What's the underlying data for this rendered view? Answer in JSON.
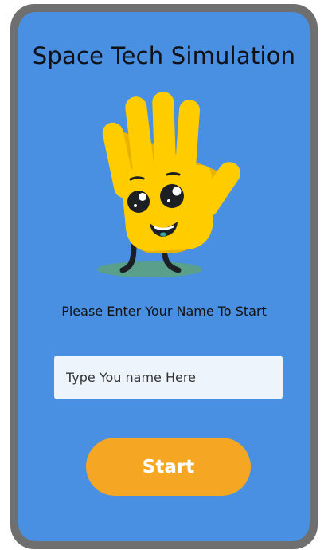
{
  "app": {
    "title": "Space Tech Simulation"
  },
  "mascot": {
    "icon": "waving-hand-mascot-icon"
  },
  "form": {
    "prompt": "Please Enter Your Name To Start",
    "name_input": {
      "placeholder": "Type You name Here",
      "value": ""
    },
    "start_label": "Start"
  },
  "colors": {
    "frame": "#6f6f6f",
    "screen": "#4a90e2",
    "button": "#f5a623",
    "input_bg": "#eef4fc",
    "mascot": "#ffcc00"
  }
}
